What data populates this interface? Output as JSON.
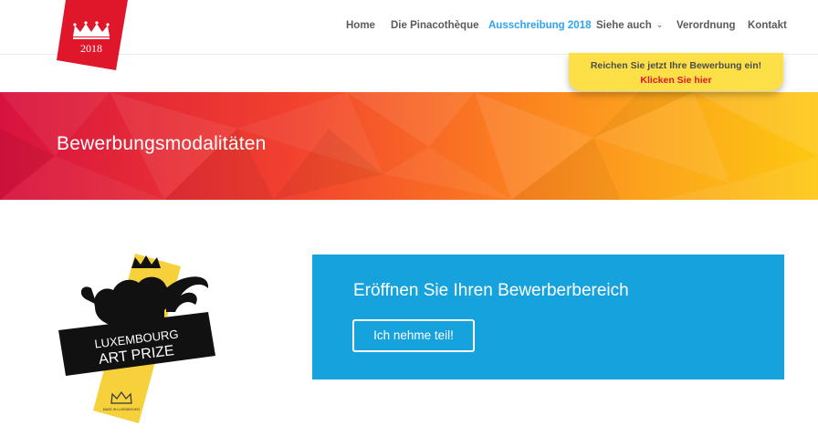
{
  "logo": {
    "year": "2018",
    "icon": "crown-icon"
  },
  "nav": {
    "items": [
      {
        "label": "Home"
      },
      {
        "label": "Die Pinacothèque"
      },
      {
        "label": "Ausschreibung 2018"
      },
      {
        "label": "Siehe auch"
      },
      {
        "label": "Verordnung"
      },
      {
        "label": "Kontakt"
      }
    ],
    "dropdown_icon": "chevron-down-icon"
  },
  "callout": {
    "line1": "Reichen Sie jetzt Ihre Bewerbung ein!",
    "line2": "Klicken Sie hier"
  },
  "hero": {
    "title": "Bewerbungsmodalitäten"
  },
  "prize_logo": {
    "line1": "LUXEMBOURG",
    "line2": "ART PRIZE",
    "small_text": "MADE IN LUXEMBOURG",
    "icon": "lion-icon"
  },
  "cta": {
    "title": "Eröffnen Sie Ihren Bewerberbereich",
    "button": "Ich nehme teil!"
  },
  "colors": {
    "nav_active": "#2ea3f2",
    "callout_bg": "#fde047",
    "callout_link": "#e0162b",
    "cta_bg": "#15a2dd",
    "logo_red": "#e0162b",
    "prize_yellow": "#f6d13b"
  }
}
